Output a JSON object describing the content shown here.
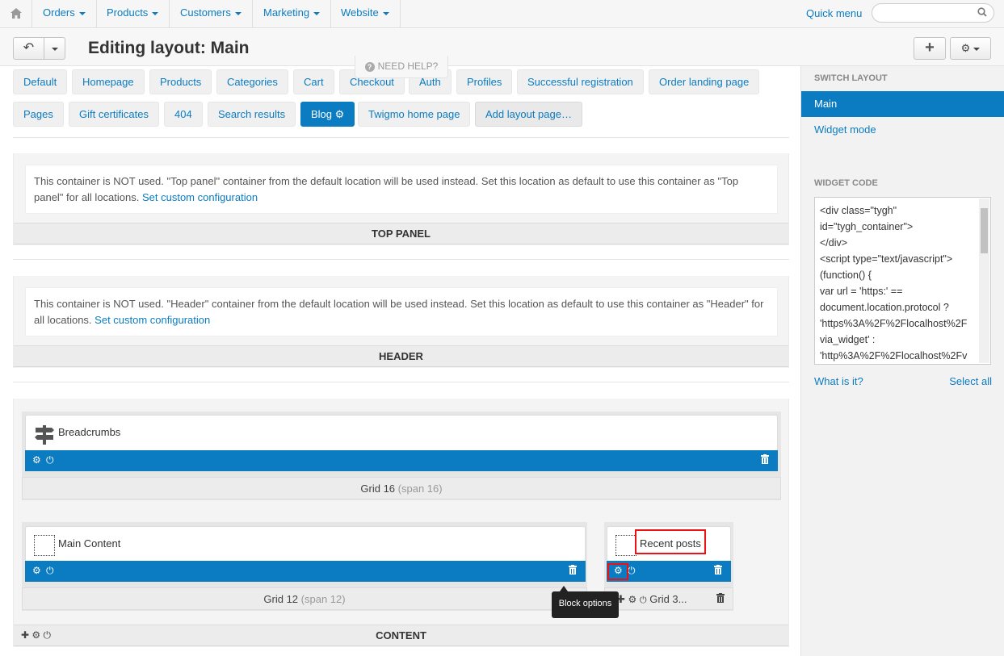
{
  "topnav": {
    "menu": [
      "Orders",
      "Products",
      "Customers",
      "Marketing",
      "Website"
    ],
    "quick_menu": "Quick menu",
    "search_placeholder": ""
  },
  "header": {
    "title": "Editing layout: Main",
    "need_help": "NEED HELP?"
  },
  "tabs_row1": [
    "Default",
    "Homepage",
    "Products",
    "Categories",
    "Cart",
    "Checkout",
    "Auth",
    "Profiles",
    "Successful registration",
    "Order landing page"
  ],
  "tabs_row2": [
    "Pages",
    "Gift certificates",
    "404",
    "Search results",
    "Blog",
    "Twigmo home page",
    "Add layout page…"
  ],
  "active_tab": "Blog",
  "containers": {
    "top_panel": {
      "notice": "This container is NOT used. \"Top panel\" container from the default location will be used instead. Set this location as default to use this container as \"Top panel\" for all locations.",
      "link": "Set custom configuration",
      "footer": "TOP PANEL"
    },
    "header": {
      "notice": "This container is NOT used. \"Header\" container from the default location will be used instead. Set this location as default to use this container as \"Header\" for all locations.",
      "link": "Set custom configuration",
      "footer": "HEADER"
    },
    "content": {
      "footer": "CONTENT",
      "blocks": {
        "breadcrumbs": "Breadcrumbs",
        "main_content": "Main Content",
        "recent_posts": "Recent posts"
      },
      "grids": {
        "grid16": {
          "label": "Grid 16",
          "span": "(span 16)"
        },
        "grid12": {
          "label": "Grid 12",
          "span": "(span 12)"
        },
        "grid3": {
          "label": "Grid 3..."
        }
      },
      "tooltip": "Block options"
    }
  },
  "sidebar": {
    "switch_layout": "SWITCH LAYOUT",
    "main": "Main",
    "widget_mode": "Widget mode",
    "widget_code": "WIDGET CODE",
    "code_lines": [
      "<div class=\"tygh\"",
      "id=\"tygh_container\">",
      "</div>",
      "<script type=\"text/javascript\">",
      "(function() {",
      "var url = 'https:' ==",
      "document.location.protocol ?",
      "'https%3A%2F%2Flocalhost%2F",
      "via_widget' :",
      "'http%3A%2F%2Flocalhost%2Fv"
    ],
    "what_is_it": "What is it?",
    "select_all": "Select all"
  },
  "colors": {
    "accent": "#0b7cc1",
    "highlight": "#e11111"
  }
}
